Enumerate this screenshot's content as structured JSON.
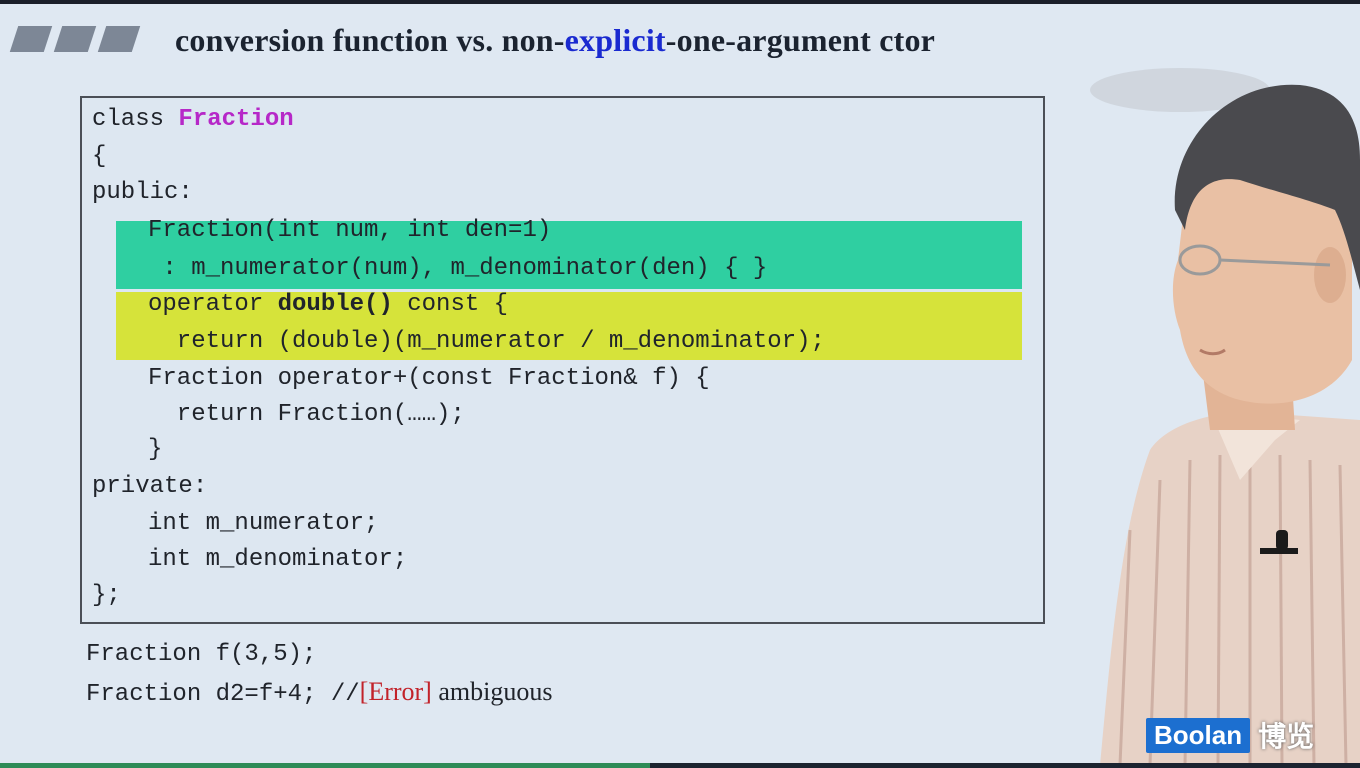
{
  "title": {
    "part1": "conversion function vs. non-",
    "keyword": "explicit",
    "part2": "-one-argument ctor"
  },
  "code": {
    "l1_kw": "class ",
    "l1_name": "Fraction",
    "l2": "{",
    "l3": "public:",
    "l4": "Fraction(int num, int den=1)",
    "l5": " : m_numerator(num), m_denominator(den) { }",
    "l6_pre": "operator ",
    "l6_bold": "double()",
    "l6_post": " const {",
    "l7": "  return (double)(m_numerator / m_denominator);",
    "l8": "Fraction operator+(const Fraction& f) {",
    "l9": "  return Fraction(……);",
    "l10": "}",
    "l11": "private:",
    "l12": "int m_numerator;",
    "l13": "int m_denominator;",
    "l14": "};"
  },
  "usage": {
    "line1": "Fraction f(3,5);",
    "line2_code": "Fraction d2=f+4; //",
    "line2_error": "[Error]",
    "line2_note": " ambiguous"
  },
  "logo": {
    "brand": "Boolan",
    "cn": "博览"
  },
  "colors": {
    "highlight_green": "#2fcfa1",
    "highlight_yellow": "#d6e33a",
    "class_name": "#b628c8",
    "title_keyword": "#1a2ad0",
    "error": "#c2222a"
  }
}
